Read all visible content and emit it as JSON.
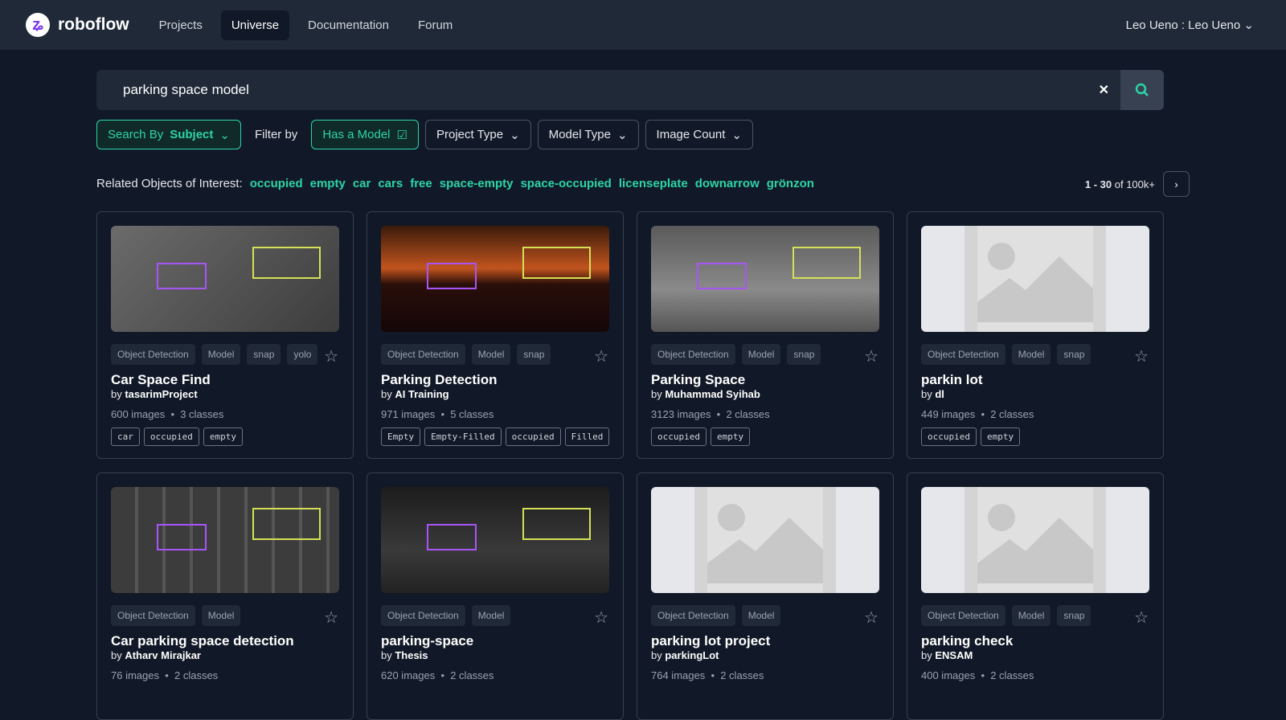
{
  "nav": {
    "brand": "roboflow",
    "items": [
      "Projects",
      "Universe",
      "Documentation",
      "Forum"
    ],
    "active": "Universe",
    "user": "Leo Ueno : Leo Ueno"
  },
  "search": {
    "value": "parking space model"
  },
  "filters": {
    "search_by_label": "Search By",
    "search_by_value": "Subject",
    "filter_by": "Filter by",
    "has_model": "Has a Model",
    "project_type": "Project Type",
    "model_type": "Model Type",
    "image_count": "Image Count"
  },
  "related": {
    "label": "Related Objects of Interest:",
    "terms": [
      "occupied",
      "empty",
      "car",
      "cars",
      "free",
      "space-empty",
      "space-occupied",
      "licenseplate",
      "downarrow",
      "grönzon"
    ]
  },
  "pager": {
    "range": "1 - 30",
    "of": "of 100k+"
  },
  "accent": "#2dd4a7",
  "cards": [
    {
      "tags": [
        "Object Detection",
        "Model",
        "snap",
        "yolo"
      ],
      "title": "Car Space Find",
      "by": "tasarimProject",
      "images": "600 images",
      "classes": "3 classes",
      "class_list": [
        "car",
        "occupied",
        "empty"
      ]
    },
    {
      "tags": [
        "Object Detection",
        "Model",
        "snap"
      ],
      "title": "Parking Detection",
      "by": "AI Training",
      "images": "971 images",
      "classes": "5 classes",
      "class_list": [
        "Empty",
        "Empty-Filled",
        "occupied",
        "Filled"
      ]
    },
    {
      "tags": [
        "Object Detection",
        "Model",
        "snap"
      ],
      "title": "Parking Space",
      "by": "Muhammad Syihab",
      "images": "3123 images",
      "classes": "2 classes",
      "class_list": [
        "occupied",
        "empty"
      ]
    },
    {
      "tags": [
        "Object Detection",
        "Model",
        "snap"
      ],
      "title": "parkin lot",
      "by": "dl",
      "images": "449 images",
      "classes": "2 classes",
      "class_list": [
        "occupied",
        "empty"
      ]
    },
    {
      "tags": [
        "Object Detection",
        "Model"
      ],
      "title": "Car parking space detection",
      "by": "Atharv Mirajkar",
      "images": "76 images",
      "classes": "2 classes",
      "class_list": []
    },
    {
      "tags": [
        "Object Detection",
        "Model"
      ],
      "title": "parking-space",
      "by": "Thesis",
      "images": "620 images",
      "classes": "2 classes",
      "class_list": []
    },
    {
      "tags": [
        "Object Detection",
        "Model"
      ],
      "title": "parking lot project",
      "by": "parkingLot",
      "images": "764 images",
      "classes": "2 classes",
      "class_list": []
    },
    {
      "tags": [
        "Object Detection",
        "Model",
        "snap"
      ],
      "title": "parking check",
      "by": "ENSAM",
      "images": "400 images",
      "classes": "2 classes",
      "class_list": []
    }
  ]
}
